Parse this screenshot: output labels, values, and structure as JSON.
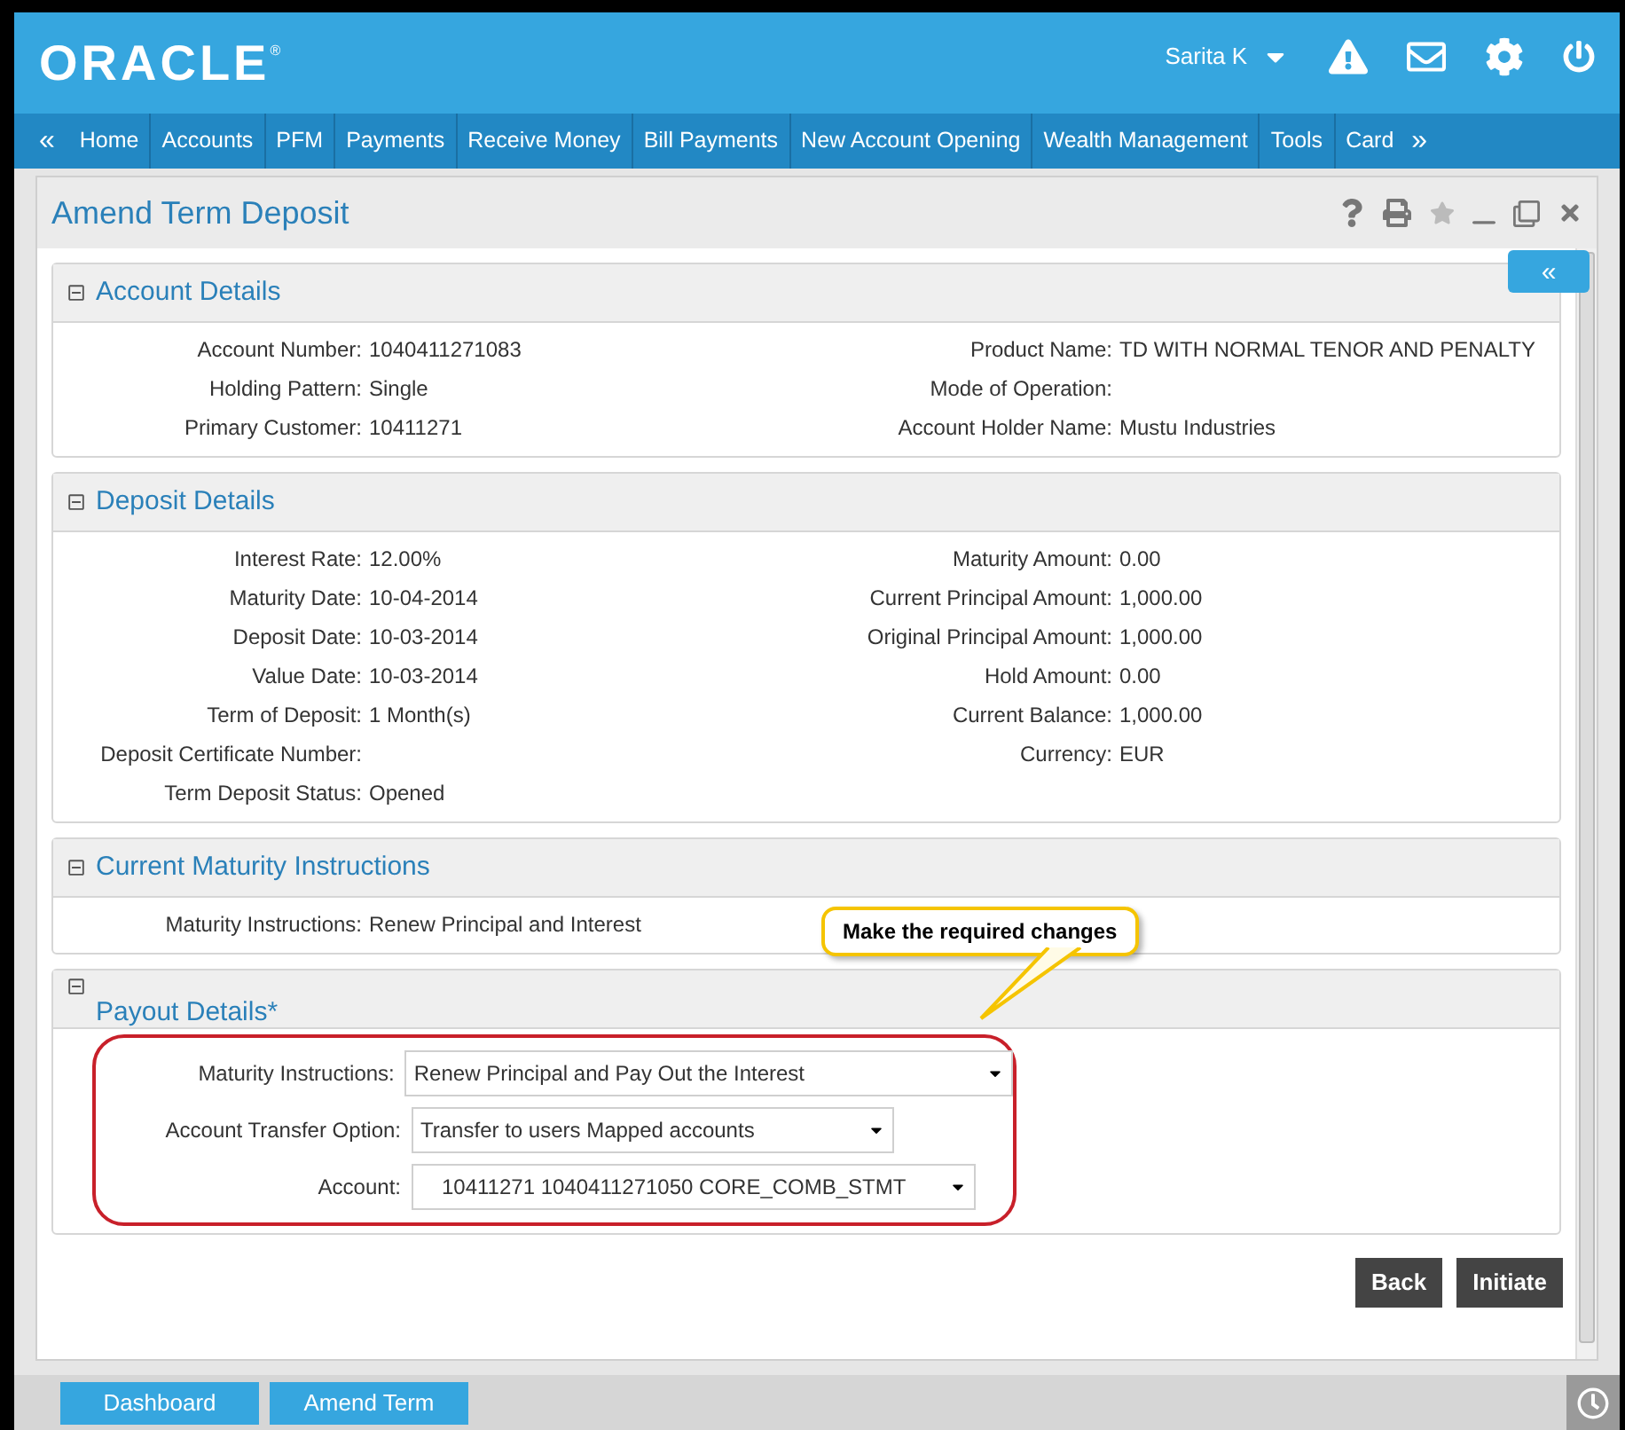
{
  "header": {
    "logo": "ORACLE",
    "logo_mark": "®",
    "user": "Sarita K"
  },
  "nav": {
    "prev": "«",
    "next": "»",
    "items": [
      {
        "label": "Home"
      },
      {
        "label": "Accounts"
      },
      {
        "label": "PFM"
      },
      {
        "label": "Payments"
      },
      {
        "label": "Receive Money"
      },
      {
        "label": "Bill Payments"
      },
      {
        "label": "New Account Opening"
      },
      {
        "label": "Wealth Management"
      },
      {
        "label": "Tools"
      },
      {
        "label": "Card"
      }
    ]
  },
  "page": {
    "title": "Amend Term Deposit",
    "collapse_button": "«"
  },
  "sections": [
    {
      "kind": "info",
      "title": "Account Details",
      "expanded": true,
      "left": [
        {
          "label": "Account Number:",
          "value": "1040411271083"
        },
        {
          "label": "Holding Pattern:",
          "value": "Single"
        },
        {
          "label": "Primary Customer:",
          "value": "10411271"
        }
      ],
      "right": [
        {
          "label": "Product Name:",
          "value": "TD WITH NORMAL TENOR AND PENALTY"
        },
        {
          "label": "Mode of Operation:"
        },
        {
          "label": "Account Holder Name:",
          "value": "Mustu Industries"
        }
      ]
    },
    {
      "kind": "info",
      "title": "Deposit Details",
      "expanded": true,
      "left": [
        {
          "label": "Interest Rate:",
          "value": "12.00%"
        },
        {
          "label": "Maturity Date:",
          "value": "10-04-2014"
        },
        {
          "label": "Deposit Date:",
          "value": "10-03-2014"
        },
        {
          "label": "Value Date:",
          "value": "10-03-2014"
        },
        {
          "label": "Term of Deposit:",
          "value": "1 Month(s)"
        },
        {
          "label": "Deposit Certificate Number:"
        },
        {
          "label": "Term Deposit Status:",
          "value": "Opened"
        }
      ],
      "right": [
        {
          "label": "Maturity Amount:",
          "value": "0.00"
        },
        {
          "label": "Current Principal Amount:",
          "value": "1,000.00"
        },
        {
          "label": "Original Principal Amount:",
          "value": "1,000.00"
        },
        {
          "label": "Hold Amount:",
          "value": "0.00"
        },
        {
          "label": "Current Balance:",
          "value": "1,000.00"
        },
        {
          "label": "Currency:",
          "value": "EUR"
        }
      ]
    },
    {
      "kind": "info",
      "title": "Current Maturity Instructions",
      "expanded": true,
      "left": [
        {
          "label": "Maturity Instructions:",
          "value": "Renew Principal and Interest"
        }
      ]
    },
    {
      "kind": "form",
      "title": "Payout Details*",
      "expanded": true,
      "fields": [
        {
          "label": "Maturity Instructions:",
          "value": "Renew Principal and Pay Out the Interest"
        },
        {
          "label": "Account Transfer Option:",
          "value": "Transfer to users Mapped accounts"
        },
        {
          "label": "Account:",
          "value": "10411271 1040411271050 CORE_COMB_STMT"
        }
      ]
    }
  ],
  "callout": "Make the required changes",
  "buttons": [
    {
      "label": "Back"
    },
    {
      "label": "Initiate"
    }
  ],
  "bottom_tabs": [
    {
      "label": "Dashboard"
    },
    {
      "label": "Amend Term"
    }
  ]
}
